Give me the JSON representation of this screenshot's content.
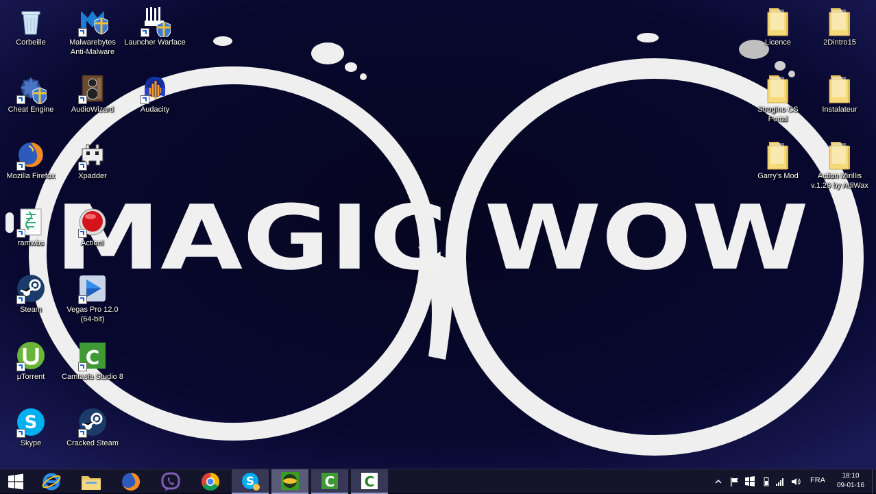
{
  "wallpaper": {
    "text": "MAGIC WOW"
  },
  "desktop_icons_left": [
    {
      "label": "Corbeille",
      "icon": "recycle-bin-icon"
    },
    {
      "label": "Malwarebytes Anti-Malware",
      "icon": "malwarebytes-icon"
    },
    {
      "label": "Launcher Warface",
      "icon": "warface-icon"
    },
    {
      "label": "Cheat Engine",
      "icon": "cheat-engine-icon"
    },
    {
      "label": "AudioWizard",
      "icon": "audiowizard-icon"
    },
    {
      "label": "Audacity",
      "icon": "audacity-icon"
    },
    {
      "label": "Mozilla Firefox",
      "icon": "firefox-icon"
    },
    {
      "label": "Xpadder",
      "icon": "xpadder-icon"
    },
    {
      "label": "ramwbs",
      "icon": "ramwbs-icon"
    },
    {
      "label": "Action!",
      "icon": "action-icon"
    },
    {
      "label": "Steam",
      "icon": "steam-icon"
    },
    {
      "label": "Vegas Pro 12.0 (64-bit)",
      "icon": "vegas-icon"
    },
    {
      "label": "µTorrent",
      "icon": "utorrent-icon"
    },
    {
      "label": "Camtasia Studio 8",
      "icon": "camtasia-icon"
    },
    {
      "label": "Skype",
      "icon": "skype-icon"
    },
    {
      "label": "Cracked Steam",
      "icon": "steam-icon"
    }
  ],
  "desktop_icons_right": [
    {
      "label": "Licence",
      "icon": "folder-icon"
    },
    {
      "label": "2Dintro15",
      "icon": "folder-icon"
    },
    {
      "label": "Strogino CS Portal",
      "icon": "folder-icon"
    },
    {
      "label": "Instalateur",
      "icon": "folder-icon"
    },
    {
      "label": "Garry's Mod",
      "icon": "folder-icon"
    },
    {
      "label": "Action Mirillis v.1.29 by AdiWax",
      "icon": "folder-icon"
    }
  ],
  "taskbar": {
    "pinned": [
      "start-icon",
      "internet-explorer-icon",
      "file-explorer-icon",
      "firefox-icon",
      "viber-icon",
      "chrome-icon",
      "skype-icon",
      "game-icon",
      "camtasia-icon",
      "camtasia-recorder-icon"
    ],
    "tray": {
      "language": "FRA",
      "time": "18:10",
      "date": "09-01-16"
    }
  },
  "colors": {
    "background": "#05051a",
    "splash": "#f2f2f2",
    "taskbar": "#14142a",
    "folder": "#f2d572"
  }
}
